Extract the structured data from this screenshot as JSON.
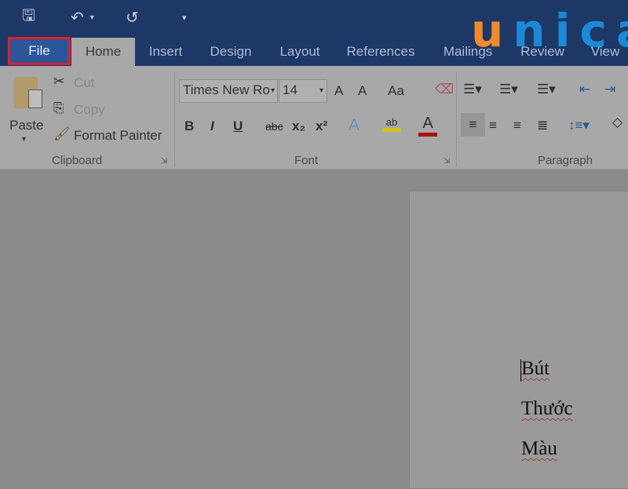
{
  "qat": {
    "icons": [
      "save-icon",
      "undo-icon",
      "redo-icon",
      "customize-qat-icon"
    ]
  },
  "logo": {
    "text": "unica",
    "first": "u",
    "rest": "nica"
  },
  "tabs": [
    "File",
    "Home",
    "Insert",
    "Design",
    "Layout",
    "References",
    "Mailings",
    "Review",
    "View"
  ],
  "highlight_color": "#e0202a",
  "clipboard": {
    "paste": "Paste",
    "cut": "Cut",
    "copy": "Copy",
    "format_painter": "Format Painter",
    "label": "Clipboard"
  },
  "font": {
    "name": "Times New Ro",
    "size": "14",
    "label": "Font",
    "grow": "A",
    "shrink": "A",
    "case": "Aa",
    "bold": "B",
    "italic": "I",
    "underline": "U",
    "strike": "abc",
    "sub": "x₂",
    "sup": "x²",
    "effects": "A",
    "highlight": "ab",
    "color": "A",
    "highlight_color": "#d4c21a",
    "font_color": "#b01010"
  },
  "paragraph": {
    "label": "Paragraph"
  },
  "document": {
    "lines": [
      "Bút",
      "Thước",
      "Màu"
    ]
  }
}
